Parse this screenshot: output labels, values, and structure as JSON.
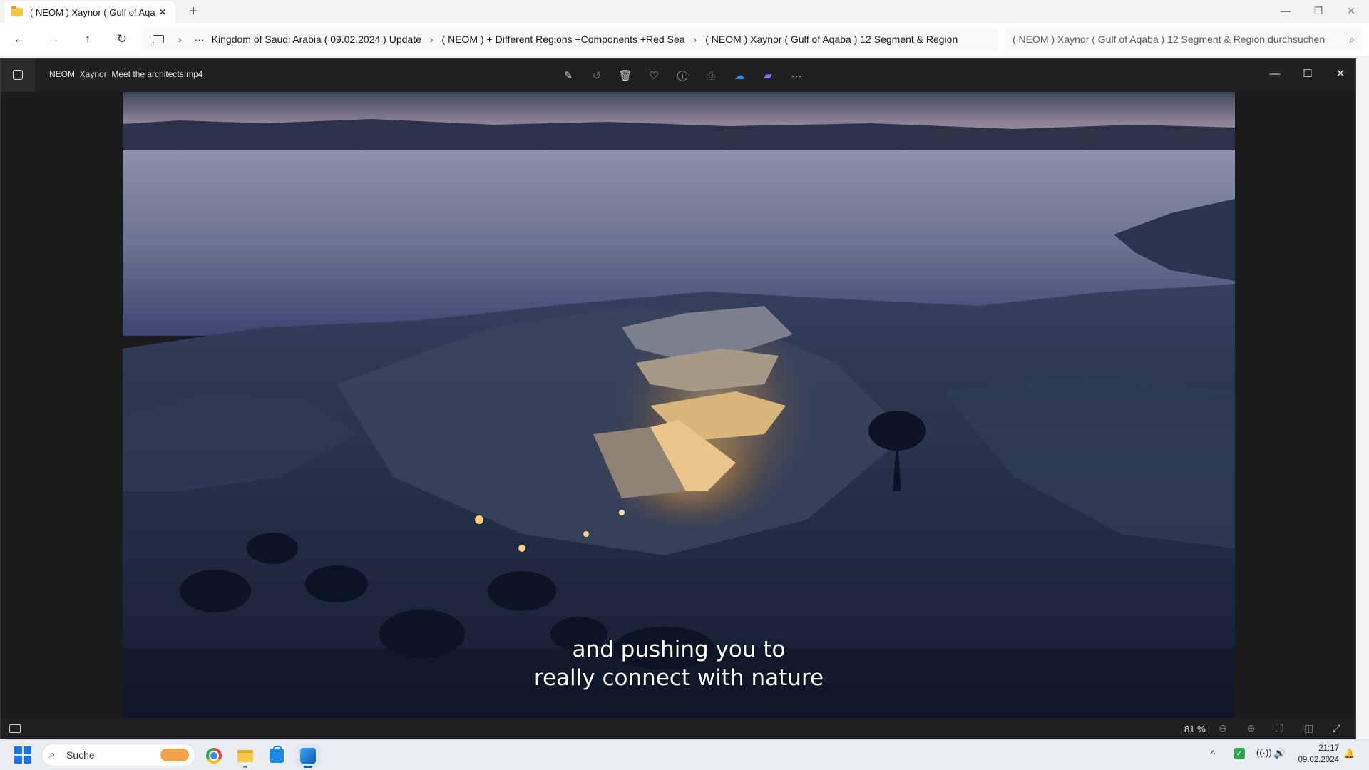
{
  "explorer": {
    "tab_title": "( NEOM ) Xaynor ( Gulf of Aqa",
    "tab_close": "✕",
    "new_tab": "+",
    "window_controls": {
      "minimize": "—",
      "restore": "❐",
      "close": "✕"
    },
    "nav": {
      "back": "←",
      "forward": "→",
      "up": "↑",
      "refresh": "↻",
      "chevron": "›",
      "more": "···"
    },
    "breadcrumbs": [
      "Kingdom of Saudi Arabia ( 09.02.2024 ) Update",
      "( NEOM ) + Different Regions +Components +Red Sea",
      "( NEOM ) Xaynor ( Gulf of Aqaba ) 12 Segment & Region"
    ],
    "search_placeholder": "( NEOM ) Xaynor ( Gulf of Aqaba ) 12 Segment & Region durchsuchen",
    "search_icon": "⌕"
  },
  "photos": {
    "file_title": "NEOM  Xaynor  Meet the architects.mp4",
    "toolbar": [
      {
        "name": "edit-icon",
        "glyph": "✎",
        "enabled": true
      },
      {
        "name": "rotate-icon",
        "glyph": "↺",
        "enabled": false
      },
      {
        "name": "delete-icon",
        "glyph": "🗑",
        "enabled": true
      },
      {
        "name": "favorite-icon",
        "glyph": "♡",
        "enabled": true
      },
      {
        "name": "info-icon",
        "glyph": "ⓘ",
        "enabled": true
      },
      {
        "name": "print-icon",
        "glyph": "⎙",
        "enabled": false
      },
      {
        "name": "onedrive-icon",
        "glyph": "☁",
        "enabled": true
      },
      {
        "name": "clipchamp-icon",
        "glyph": "▰",
        "enabled": true
      },
      {
        "name": "more-icon",
        "glyph": "···",
        "enabled": true
      }
    ],
    "window_controls": {
      "minimize": "—",
      "maximize": "☐",
      "close": "✕"
    },
    "subtitle_line1": "and pushing you to",
    "subtitle_line2": "really connect with nature",
    "zoom": "81 %",
    "status_icons": {
      "zoom_out": "⊖",
      "zoom_in": "⊕",
      "fit": "⛶",
      "actual": "◫",
      "fullscreen": "⤢"
    }
  },
  "taskbar": {
    "search_label": "Suche",
    "search_icon": "⌕",
    "tray_up": "^",
    "defender": "✓",
    "wifi": "((·))",
    "volume": "🔊",
    "time": "21:17",
    "date": "09.02.2024",
    "bell": "🔔"
  },
  "colors": {
    "accent": "#0067c0",
    "photos_bg": "#202020",
    "explorer_bg": "#f3f3f3"
  }
}
